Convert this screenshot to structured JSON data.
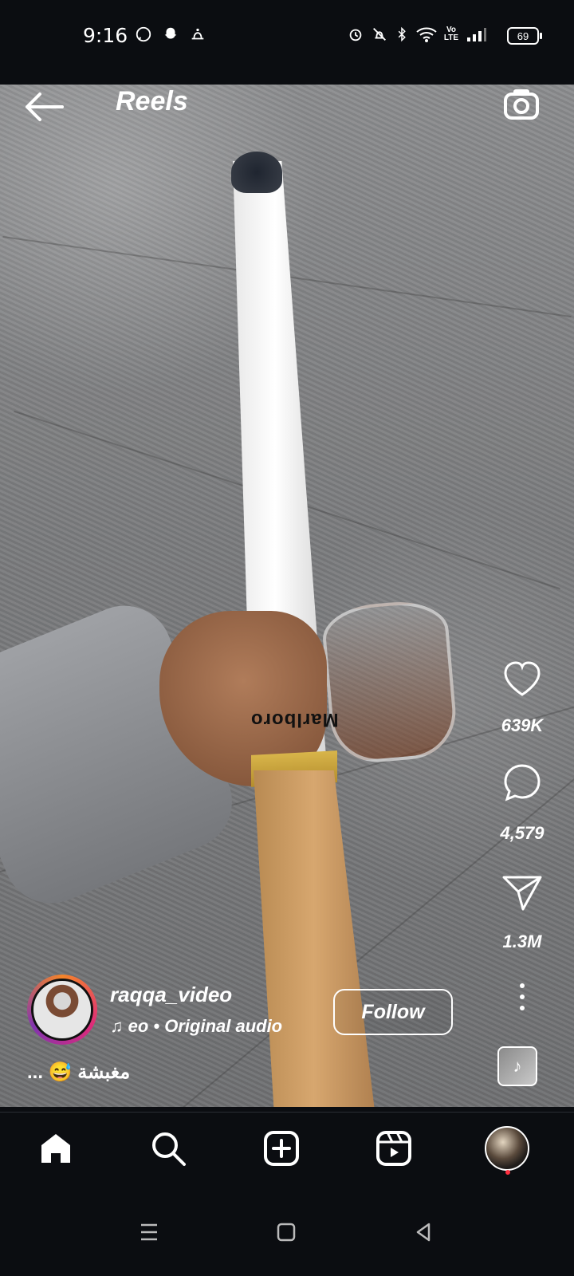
{
  "status_bar": {
    "time": "9:16",
    "battery": "69",
    "icons": [
      "whatsapp-icon",
      "snapchat-icon",
      "notification-icon",
      "alarm-icon",
      "silent-icon",
      "bluetooth-icon",
      "wifi-icon",
      "volte-icon",
      "signal-icon",
      "battery-icon"
    ],
    "volte_line1": "Vo",
    "volte_line2": "LTE"
  },
  "header": {
    "title": "Reels"
  },
  "reel": {
    "brand_text": "Marlboro"
  },
  "actions": {
    "likes": "639K",
    "comments": "4,579",
    "shares": "1.3M"
  },
  "creator": {
    "username": "raqqa_video",
    "audio": "eo • Original audio",
    "follow_label": "Follow",
    "caption": "مغبشة 😅 ..."
  },
  "bottom_nav": {
    "items": [
      "home-icon",
      "search-icon",
      "create-icon",
      "reels-icon",
      "profile-avatar"
    ]
  },
  "colors": {
    "background": "#0b0d11",
    "text": "#ffffff",
    "notification_dot": "#ff3040",
    "story_ring_start": "#f58529",
    "story_ring_end": "#dd2a7b"
  }
}
